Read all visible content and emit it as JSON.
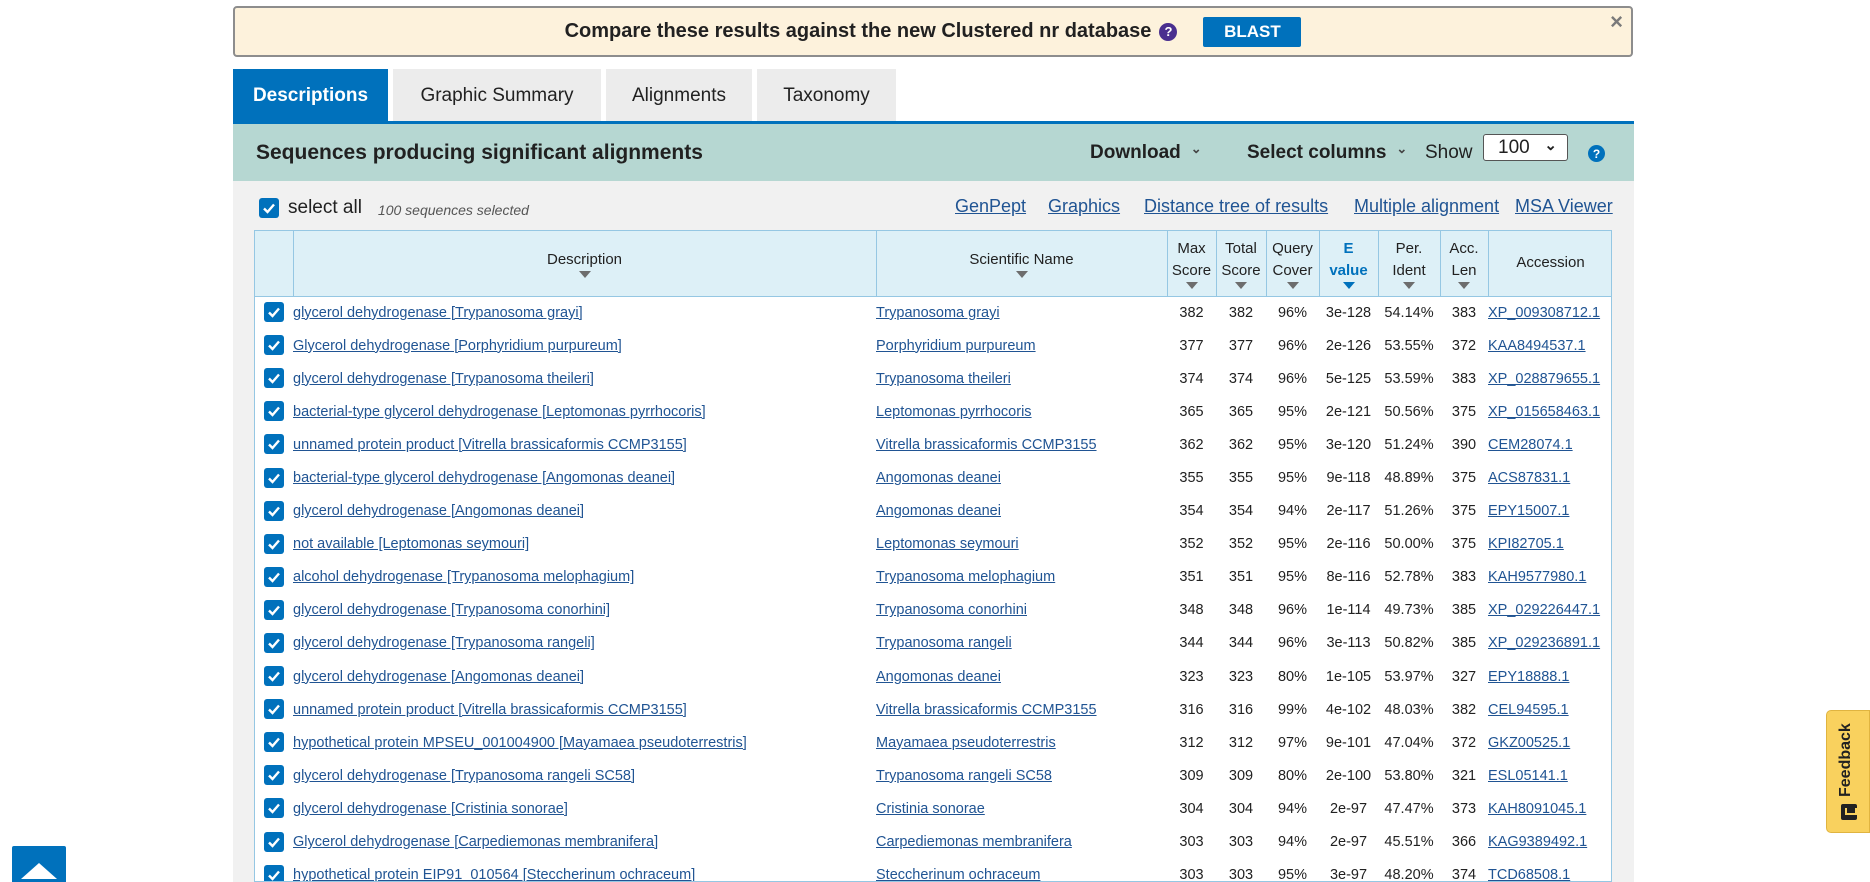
{
  "banner": {
    "text": "Compare these results against the new Clustered nr database",
    "help": "?",
    "button": "BLAST",
    "close": "×"
  },
  "tabs": [
    {
      "label": "Descriptions",
      "active": true
    },
    {
      "label": "Graphic Summary",
      "active": false
    },
    {
      "label": "Alignments",
      "active": false
    },
    {
      "label": "Taxonomy",
      "active": false
    }
  ],
  "results": {
    "title": "Sequences producing significant alignments",
    "download": "Download",
    "select_columns": "Select columns",
    "show_label": "Show",
    "show_value": "100",
    "help": "?"
  },
  "toolbar": {
    "select_all": "select all",
    "selected_count": "100 sequences selected",
    "links": [
      "GenPept",
      "Graphics",
      "Distance tree of results",
      "Multiple alignment",
      "MSA Viewer"
    ]
  },
  "table": {
    "headers": {
      "description": "Description",
      "scientific_name": "Scientific Name",
      "max_score": [
        "Max",
        "Score"
      ],
      "total_score": [
        "Total",
        "Score"
      ],
      "query_cover": [
        "Query",
        "Cover"
      ],
      "e_value": [
        "E",
        "value"
      ],
      "per_ident": [
        "Per.",
        "Ident"
      ],
      "acc_len": [
        "Acc.",
        "Len"
      ],
      "accession": "Accession"
    },
    "rows": [
      [
        "glycerol dehydrogenase [Trypanosoma grayi]",
        "Trypanosoma grayi",
        "382",
        "382",
        "96%",
        "3e-128",
        "54.14%",
        "383",
        "XP_009308712.1"
      ],
      [
        "Glycerol dehydrogenase [Porphyridium purpureum]",
        "Porphyridium purpureum",
        "377",
        "377",
        "96%",
        "2e-126",
        "53.55%",
        "372",
        "KAA8494537.1"
      ],
      [
        "glycerol dehydrogenase [Trypanosoma theileri]",
        "Trypanosoma theileri",
        "374",
        "374",
        "96%",
        "5e-125",
        "53.59%",
        "383",
        "XP_028879655.1"
      ],
      [
        "bacterial-type glycerol dehydrogenase [Leptomonas pyrrhocoris]",
        "Leptomonas pyrrhocoris",
        "365",
        "365",
        "95%",
        "2e-121",
        "50.56%",
        "375",
        "XP_015658463.1"
      ],
      [
        "unnamed protein product [Vitrella brassicaformis CCMP3155]",
        "Vitrella brassicaformis CCMP3155",
        "362",
        "362",
        "95%",
        "3e-120",
        "51.24%",
        "390",
        "CEM28074.1"
      ],
      [
        "bacterial-type glycerol dehydrogenase [Angomonas deanei]",
        "Angomonas deanei",
        "355",
        "355",
        "95%",
        "9e-118",
        "48.89%",
        "375",
        "ACS87831.1"
      ],
      [
        "glycerol dehydrogenase [Angomonas deanei]",
        "Angomonas deanei",
        "354",
        "354",
        "94%",
        "2e-117",
        "51.26%",
        "375",
        "EPY15007.1"
      ],
      [
        "not available [Leptomonas seymouri]",
        "Leptomonas seymouri",
        "352",
        "352",
        "95%",
        "2e-116",
        "50.00%",
        "375",
        "KPI82705.1"
      ],
      [
        "alcohol dehydrogenase [Trypanosoma melophagium]",
        "Trypanosoma melophagium",
        "351",
        "351",
        "95%",
        "8e-116",
        "52.78%",
        "383",
        "KAH9577980.1"
      ],
      [
        "glycerol dehydrogenase [Trypanosoma conorhini]",
        "Trypanosoma conorhini",
        "348",
        "348",
        "96%",
        "1e-114",
        "49.73%",
        "385",
        "XP_029226447.1"
      ],
      [
        "glycerol dehydrogenase [Trypanosoma rangeli]",
        "Trypanosoma rangeli",
        "344",
        "344",
        "96%",
        "3e-113",
        "50.82%",
        "385",
        "XP_029236891.1"
      ],
      [
        "glycerol dehydrogenase [Angomonas deanei]",
        "Angomonas deanei",
        "323",
        "323",
        "80%",
        "1e-105",
        "53.97%",
        "327",
        "EPY18888.1"
      ],
      [
        "unnamed protein product [Vitrella brassicaformis CCMP3155]",
        "Vitrella brassicaformis CCMP3155",
        "316",
        "316",
        "99%",
        "4e-102",
        "48.03%",
        "382",
        "CEL94595.1"
      ],
      [
        "hypothetical protein MPSEU_001004900 [Mayamaea pseudoterrestris]",
        "Mayamaea pseudoterrestris",
        "312",
        "312",
        "97%",
        "9e-101",
        "47.04%",
        "372",
        "GKZ00525.1"
      ],
      [
        "glycerol dehydrogenase [Trypanosoma rangeli SC58]",
        "Trypanosoma rangeli SC58",
        "309",
        "309",
        "80%",
        "2e-100",
        "53.80%",
        "321",
        "ESL05141.1"
      ],
      [
        "glycerol dehydrogenase [Cristinia sonorae]",
        "Cristinia sonorae",
        "304",
        "304",
        "94%",
        "2e-97",
        "47.47%",
        "373",
        "KAH8091045.1"
      ],
      [
        "Glycerol dehydrogenase [Carpediemonas membranifera]",
        "Carpediemonas membranifera",
        "303",
        "303",
        "94%",
        "2e-97",
        "45.51%",
        "366",
        "KAG9389492.1"
      ],
      [
        "hypothetical protein EIP91_010564 [Steccherinum ochraceum]",
        "Steccherinum ochraceum",
        "303",
        "303",
        "95%",
        "3e-97",
        "48.20%",
        "374",
        "TCD68508.1"
      ]
    ]
  },
  "feedback": "Feedback",
  "colors": {
    "primary": "#0071bc",
    "link": "#205493",
    "banner_bg": "#fdf2dc",
    "header_bg": "#b6d7d2",
    "table_header_bg": "#ddf0f7",
    "feedback_bg": "#f9d15e"
  },
  "icons": [
    "help-icon",
    "close-icon",
    "chevron-down-icon",
    "checkbox-checked-icon",
    "sort-arrow-icon",
    "feedback-icon",
    "scroll-to-top-icon"
  ]
}
